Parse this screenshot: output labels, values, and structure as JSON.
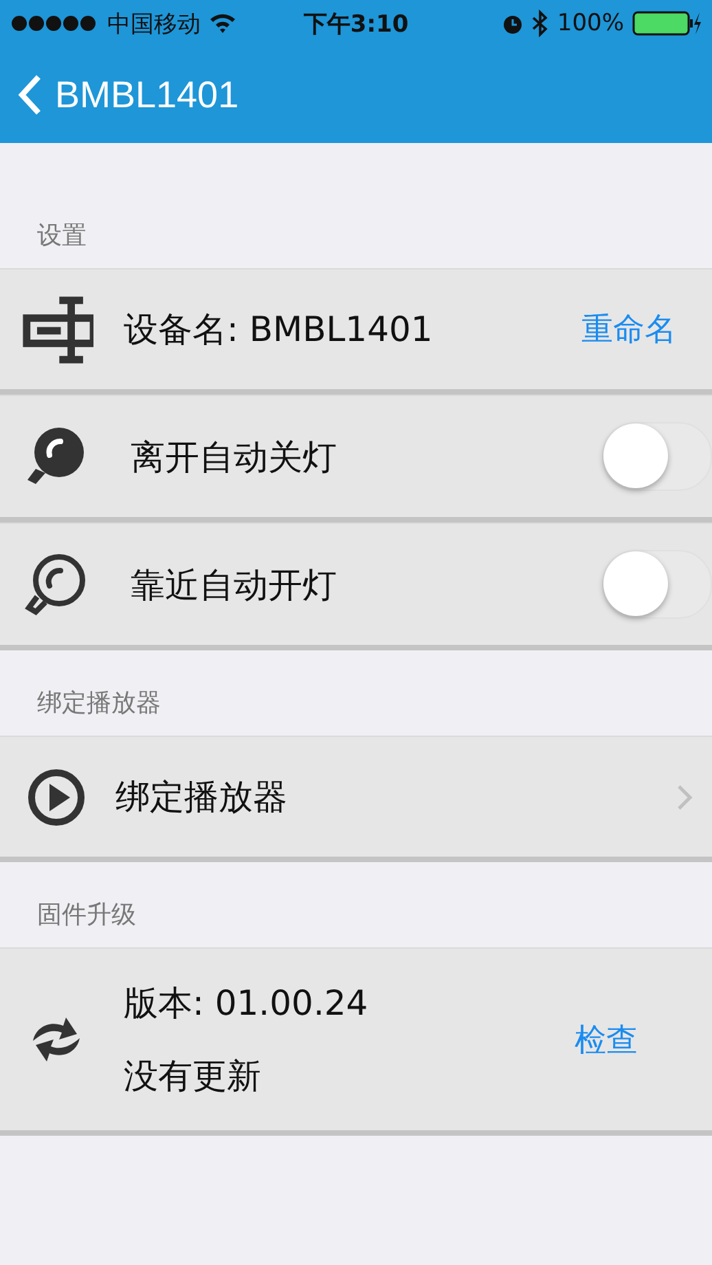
{
  "status_bar": {
    "carrier": "中国移动",
    "time": "下午3:10",
    "battery": "100%"
  },
  "nav": {
    "title": "BMBL1401"
  },
  "sections": [
    {
      "header": "设置",
      "rows": [
        {
          "kind": "action",
          "label": "设备名: BMBL1401",
          "action": "重命名"
        },
        {
          "kind": "toggle",
          "label": "离开自动关灯",
          "on": false
        },
        {
          "kind": "toggle",
          "label": "靠近自动开灯",
          "on": false
        }
      ]
    },
    {
      "header": "绑定播放器",
      "rows": [
        {
          "kind": "link",
          "label": "绑定播放器"
        }
      ]
    },
    {
      "header": "固件升级",
      "rows": [
        {
          "kind": "detail",
          "lines": [
            "版本: 01.00.24",
            "没有更新"
          ],
          "action": "检查"
        }
      ]
    }
  ]
}
